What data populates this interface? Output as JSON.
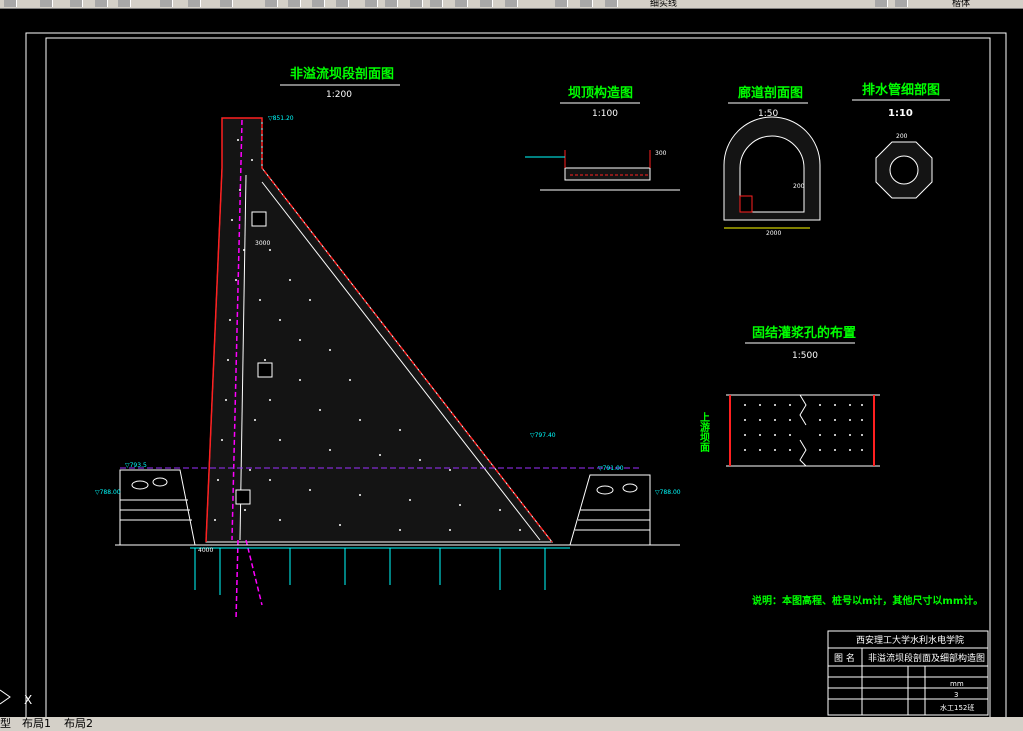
{
  "toolbar": {
    "layer_combo": "细实线",
    "right_combo": "楷体"
  },
  "drawing": {
    "main_title": "非溢流坝段剖面图",
    "main_scale": "1:200",
    "crest_title": "坝顶构造图",
    "crest_scale": "1:100",
    "gallery_title": "廊道剖面图",
    "gallery_scale": "1:50",
    "drain_title": "排水管细部图",
    "drain_scale": "1:10",
    "grout_title": "固结灌浆孔的布置",
    "grout_scale": "1:500",
    "upstream_face": "上游坝面",
    "note": "说明：本图高程、桩号以m计，其他尺寸以mm计。",
    "elev_left_a": "▽788.00",
    "elev_left_b": "▽793.5",
    "elev_right_a": "▽788.00",
    "elev_right_b": "▽791.00",
    "elev_mid": "▽797.40",
    "elev_crest": "▽851.20",
    "dim_4000": "4000",
    "dim_3000": "3000",
    "dim_300": "300",
    "dim_200": "200",
    "dim_2000": "2000"
  },
  "title_block": {
    "school": "西安理工大学水利水电学院",
    "label_drawing_name": "图 名",
    "drawing_name": "非溢流坝段剖面及细部构造图",
    "unit": "mm",
    "sheet": "3",
    "class": "水工152班"
  },
  "axis_icon": {
    "x": "X"
  },
  "layout_tabs": [
    "型",
    "布局1",
    "布局2"
  ]
}
